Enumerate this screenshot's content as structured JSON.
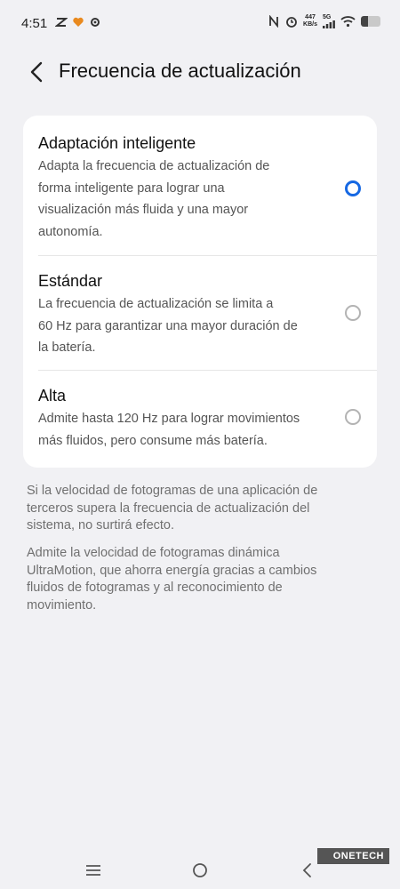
{
  "status_bar": {
    "time": "4:51",
    "speed_value": "447",
    "speed_unit": "KB/s",
    "network": "5G",
    "battery_level": 0.35,
    "icons": [
      "link-icon",
      "heart-icon",
      "gear-icon",
      "nfc-icon",
      "alarm-icon",
      "signal-icon",
      "wifi-icon",
      "battery-icon"
    ]
  },
  "header": {
    "title": "Frecuencia de actualización"
  },
  "options": [
    {
      "title": "Adaptación inteligente",
      "lines": [
        "Adapta la frecuencia de actualización de",
        "forma inteligente para lograr una",
        "visualización más fluida y una mayor",
        "autonomía."
      ],
      "selected": true
    },
    {
      "title": "Estándar",
      "lines": [
        "La frecuencia de actualización se limita a",
        "60 Hz para garantizar una mayor duración de",
        "la batería."
      ],
      "selected": false
    },
    {
      "title": "Alta",
      "lines": [
        "Admite hasta 120 Hz para lograr movimientos",
        "más fluidos, pero consume más batería."
      ],
      "selected": false
    }
  ],
  "notes": [
    [
      "Si la velocidad de fotogramas de una aplicación de",
      "terceros supera la frecuencia de actualización del",
      "sistema, no surtirá efecto."
    ],
    [
      "Admite la velocidad de fotogramas dinámica",
      "UltraMotion, que ahorra energía gracias a cambios",
      "fluidos de fotogramas y al reconocimiento de",
      "movimiento."
    ]
  ],
  "watermark": "ONETECH",
  "colors": {
    "accent": "#1668e3",
    "background": "#f1f1f4",
    "card": "#ffffff"
  }
}
